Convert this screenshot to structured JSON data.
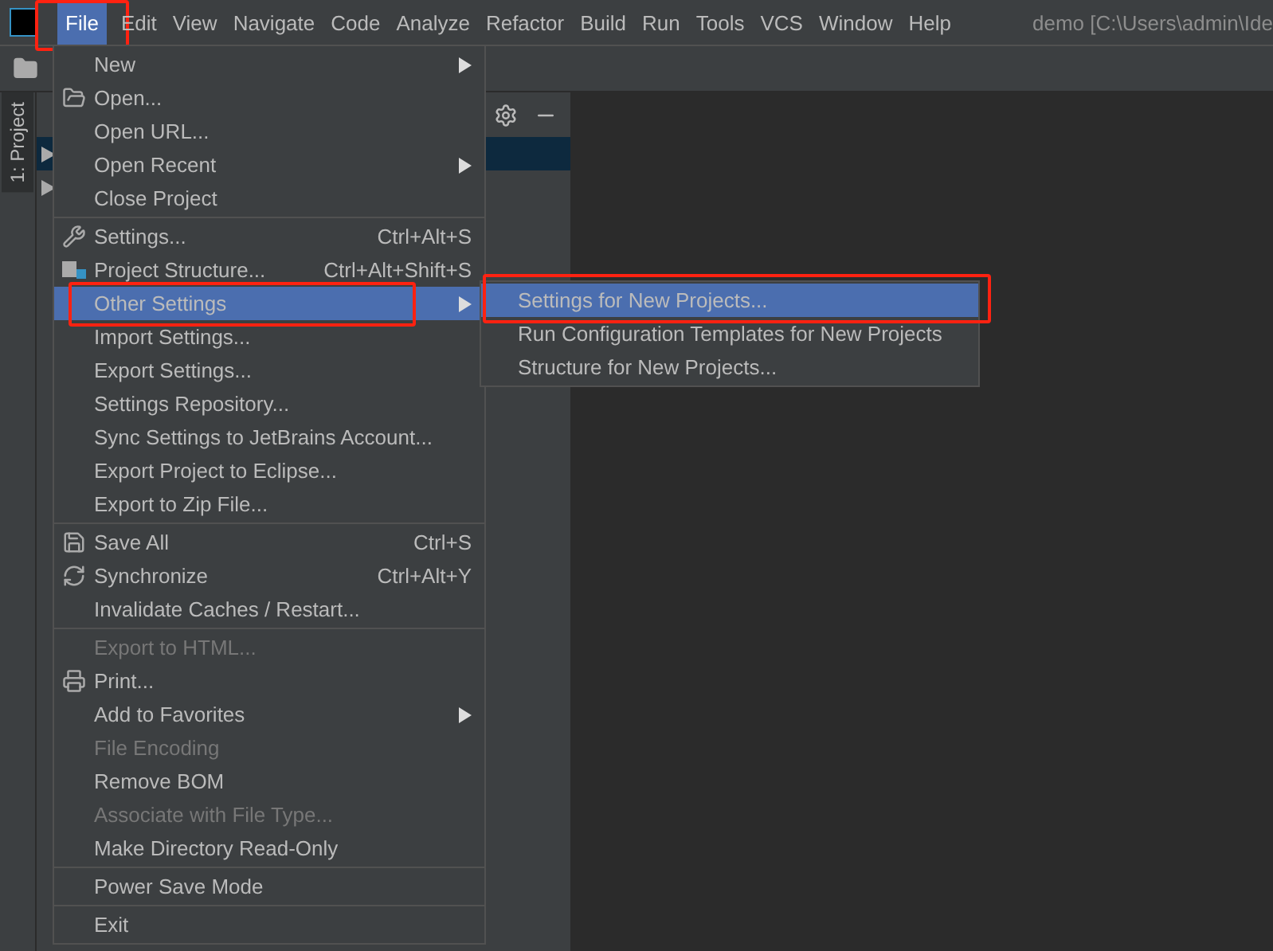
{
  "menu_bar": {
    "items": [
      {
        "label": "File",
        "selected": true,
        "highlighted": true
      },
      {
        "label": "Edit",
        "selected": false,
        "highlighted": false
      },
      {
        "label": "View",
        "selected": false,
        "highlighted": false
      },
      {
        "label": "Navigate",
        "selected": false,
        "highlighted": false
      },
      {
        "label": "Code",
        "selected": false,
        "highlighted": false
      },
      {
        "label": "Analyze",
        "selected": false,
        "highlighted": false
      },
      {
        "label": "Refactor",
        "selected": false,
        "highlighted": false
      },
      {
        "label": "Build",
        "selected": false,
        "highlighted": false
      },
      {
        "label": "Run",
        "selected": false,
        "highlighted": false
      },
      {
        "label": "Tools",
        "selected": false,
        "highlighted": false
      },
      {
        "label": "VCS",
        "selected": false,
        "highlighted": false
      },
      {
        "label": "Window",
        "selected": false,
        "highlighted": false
      },
      {
        "label": "Help",
        "selected": false,
        "highlighted": false
      }
    ],
    "window_title": "demo [C:\\Users\\admin\\Ide"
  },
  "side_tab": {
    "label": "1: Project"
  },
  "project_tree": {
    "rows": [
      {
        "selected": true
      },
      {
        "selected": false
      }
    ]
  },
  "file_menu": {
    "groups": [
      [
        {
          "label": "New",
          "kind": "plain",
          "submenu": true,
          "disabled": false,
          "selected": false,
          "highlighted": false
        },
        {
          "label": "Open...",
          "kind": "folder",
          "submenu": false,
          "disabled": false,
          "selected": false,
          "highlighted": false
        },
        {
          "label": "Open URL...",
          "kind": "plain",
          "submenu": false,
          "disabled": false,
          "selected": false,
          "highlighted": false
        },
        {
          "label": "Open Recent",
          "kind": "plain",
          "submenu": true,
          "disabled": false,
          "selected": false,
          "highlighted": false
        },
        {
          "label": "Close Project",
          "kind": "plain",
          "submenu": false,
          "disabled": false,
          "selected": false,
          "highlighted": false
        }
      ],
      [
        {
          "label": "Settings...",
          "kind": "wrench",
          "shortcut": "Ctrl+Alt+S",
          "submenu": false,
          "disabled": false,
          "selected": false,
          "highlighted": false
        },
        {
          "label": "Project Structure...",
          "kind": "structure",
          "shortcut": "Ctrl+Alt+Shift+S",
          "submenu": false,
          "disabled": false,
          "selected": false,
          "highlighted": false
        },
        {
          "label": "Other Settings",
          "kind": "plain",
          "submenu": true,
          "disabled": false,
          "selected": true,
          "highlighted": true
        },
        {
          "label": "Import Settings...",
          "kind": "plain",
          "submenu": false,
          "disabled": false,
          "selected": false,
          "highlighted": false
        },
        {
          "label": "Export Settings...",
          "kind": "plain",
          "submenu": false,
          "disabled": false,
          "selected": false,
          "highlighted": false
        },
        {
          "label": "Settings Repository...",
          "kind": "plain",
          "submenu": false,
          "disabled": false,
          "selected": false,
          "highlighted": false
        },
        {
          "label": "Sync Settings to JetBrains Account...",
          "kind": "plain",
          "submenu": false,
          "disabled": false,
          "selected": false,
          "highlighted": false
        },
        {
          "label": "Export Project to Eclipse...",
          "kind": "plain",
          "submenu": false,
          "disabled": false,
          "selected": false,
          "highlighted": false
        },
        {
          "label": "Export to Zip File...",
          "kind": "plain",
          "submenu": false,
          "disabled": false,
          "selected": false,
          "highlighted": false
        }
      ],
      [
        {
          "label": "Save All",
          "kind": "save",
          "shortcut": "Ctrl+S",
          "submenu": false,
          "disabled": false,
          "selected": false,
          "highlighted": false
        },
        {
          "label": "Synchronize",
          "kind": "sync",
          "shortcut": "Ctrl+Alt+Y",
          "submenu": false,
          "disabled": false,
          "selected": false,
          "highlighted": false
        },
        {
          "label": "Invalidate Caches / Restart...",
          "kind": "plain",
          "submenu": false,
          "disabled": false,
          "selected": false,
          "highlighted": false
        }
      ],
      [
        {
          "label": "Export to HTML...",
          "kind": "plain",
          "submenu": false,
          "disabled": true,
          "selected": false,
          "highlighted": false
        },
        {
          "label": "Print...",
          "kind": "printer",
          "submenu": false,
          "disabled": false,
          "selected": false,
          "highlighted": false
        },
        {
          "label": "Add to Favorites",
          "kind": "plain",
          "submenu": true,
          "disabled": false,
          "selected": false,
          "highlighted": false
        },
        {
          "label": "File Encoding",
          "kind": "plain",
          "submenu": false,
          "disabled": true,
          "selected": false,
          "highlighted": false
        },
        {
          "label": "Remove BOM",
          "kind": "plain",
          "submenu": false,
          "disabled": false,
          "selected": false,
          "highlighted": false
        },
        {
          "label": "Associate with File Type...",
          "kind": "plain",
          "submenu": false,
          "disabled": true,
          "selected": false,
          "highlighted": false
        },
        {
          "label": "Make Directory Read-Only",
          "kind": "plain",
          "submenu": false,
          "disabled": false,
          "selected": false,
          "highlighted": false
        }
      ],
      [
        {
          "label": "Power Save Mode",
          "kind": "plain",
          "submenu": false,
          "disabled": false,
          "selected": false,
          "highlighted": false
        }
      ],
      [
        {
          "label": "Exit",
          "kind": "plain",
          "submenu": false,
          "disabled": false,
          "selected": false,
          "highlighted": false
        }
      ]
    ]
  },
  "submenu": {
    "items": [
      {
        "label": "Settings for New Projects...",
        "selected": true,
        "highlighted": true
      },
      {
        "label": "Run Configuration Templates for New Projects",
        "selected": false,
        "highlighted": false
      },
      {
        "label": "Structure for New Projects...",
        "selected": false,
        "highlighted": false
      }
    ]
  }
}
